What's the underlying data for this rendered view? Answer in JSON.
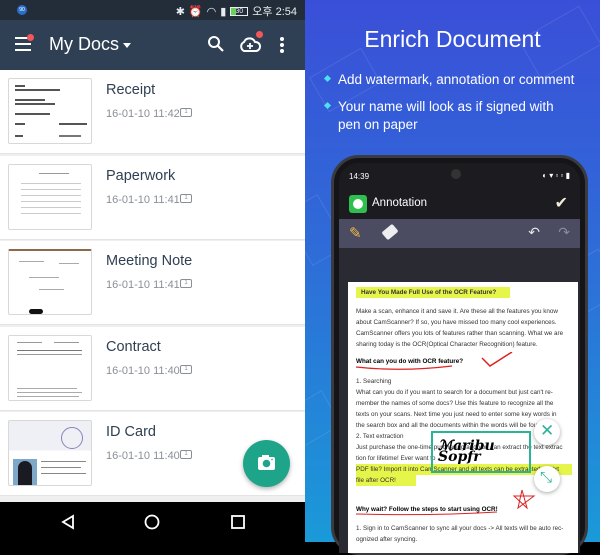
{
  "statusbar": {
    "notification_badge": "90",
    "battery": "30",
    "time": "오후 2:54"
  },
  "appbar": {
    "title": "My Docs",
    "icons": [
      "menu-icon",
      "caret-down-icon",
      "search-icon",
      "cloud-upload-icon",
      "more-vert-icon"
    ],
    "badge_color": "#f3575a"
  },
  "documents": [
    {
      "name": "Receipt",
      "date": "16-01-10 11:42",
      "pages": "1"
    },
    {
      "name": "Paperwork",
      "date": "16-01-10 11:41",
      "pages": "1"
    },
    {
      "name": "Meeting Note",
      "date": "16-01-10 11:41",
      "pages": "1"
    },
    {
      "name": "Contract",
      "date": "16-01-10 11:40",
      "pages": "1"
    },
    {
      "name": "ID Card",
      "date": "16-01-10 11:40",
      "pages": "1"
    }
  ],
  "fab": {
    "icon": "camera-icon",
    "color": "#1ea489"
  },
  "navbar": {
    "icons": [
      "back-icon",
      "home-icon",
      "recents-icon"
    ]
  },
  "promo": {
    "title": "Enrich Document",
    "bullets": [
      "Add watermark, annotation or comment",
      "Your name will look as if signed with",
      "pen on paper"
    ]
  },
  "phone": {
    "time": "14:39",
    "screen_title": "Annotation",
    "doc": {
      "heading": "Have You Made Full Use of the OCR Feature?",
      "intro": [
        "Make a scan, enhance it and save it. Are these all the features you know",
        "about CamScanner? If so, you have missed too many cool experiences.",
        "CamScanner offers you lots of features rather than scanning. What we are",
        "sharing today is the OCR(Optical Character Recognition) feature."
      ],
      "sub1": "What can you do with OCR feature?",
      "item1": "1.  Searching",
      "body1": [
        "What can you do if you want to search for a document but just can't re-",
        "member the names of some docs? Use this feature to recognize all the",
        "texts on your scans. Next time you just need to enter some key words in",
        "the search box and all the documents within the words will be found."
      ],
      "item2": "2.  Text extraction",
      "body2": [
        "Just purchase the one-time purchasing and you can extract the text extrac",
        "tion for lifetime! Ever want to ...",
        "PDF file? Import it into CamScanner and all texts can be extracted as .txt",
        "file after OCR!"
      ],
      "sub2": "Why wait? Follow the steps to start using OCR!",
      "step1": [
        "1.  Sign in to CamScanner to sync all your docs -> All texts will be auto rec-",
        "ognized after syncing."
      ]
    }
  }
}
